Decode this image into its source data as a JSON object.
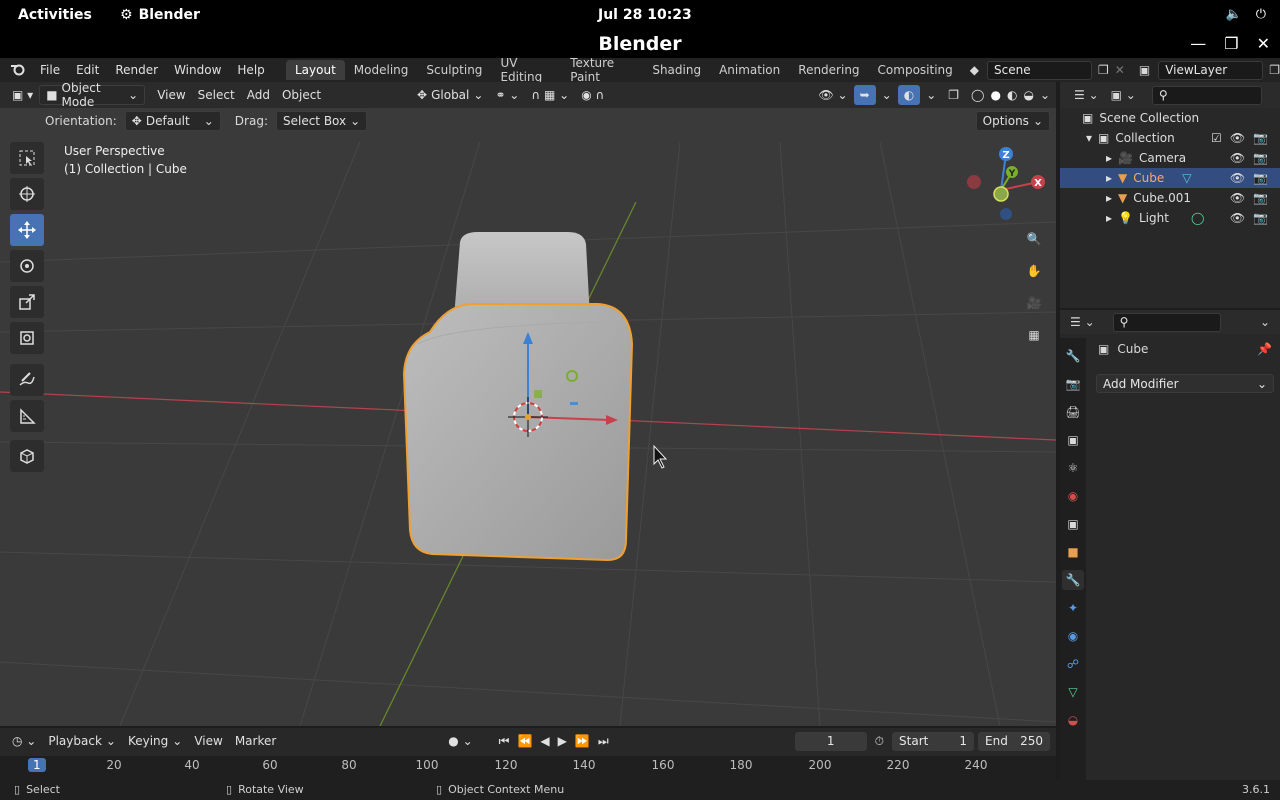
{
  "gnome": {
    "activities": "Activities",
    "app_name": "Blender",
    "clock": "Jul 28  10:23"
  },
  "window": {
    "title": "Blender"
  },
  "menu": {
    "file": "File",
    "edit": "Edit",
    "render": "Render",
    "window": "Window",
    "help": "Help"
  },
  "workspaces": [
    "Layout",
    "Modeling",
    "Sculpting",
    "UV Editing",
    "Texture Paint",
    "Shading",
    "Animation",
    "Rendering",
    "Compositing"
  ],
  "scene_field": "Scene",
  "view_layer_field": "ViewLayer",
  "viewport": {
    "mode": "Object Mode",
    "menus": {
      "view": "View",
      "select": "Select",
      "add": "Add",
      "object": "Object"
    },
    "transform_orientation": "Global",
    "orientation_label": "Orientation:",
    "orientation_value": "Default",
    "drag_label": "Drag:",
    "drag_value": "Select Box",
    "options": "Options",
    "overlay_line1": "User Perspective",
    "overlay_line2": "(1) Collection | Cube",
    "gizmo": {
      "z": "Z",
      "y": "Y",
      "x": "X"
    }
  },
  "outliner": {
    "scene_collection": "Scene Collection",
    "collection": "Collection",
    "items": [
      {
        "name": "Camera"
      },
      {
        "name": "Cube"
      },
      {
        "name": "Cube.001"
      },
      {
        "name": "Light"
      }
    ]
  },
  "properties": {
    "object_name": "Cube",
    "add_modifier": "Add Modifier"
  },
  "timeline": {
    "playback": "Playback",
    "keying": "Keying",
    "view": "View",
    "marker": "Marker",
    "current_frame": "1",
    "start_label": "Start",
    "start_value": "1",
    "end_label": "End",
    "end_value": "250",
    "ruler_marker": "1",
    "ticks": [
      "20",
      "40",
      "60",
      "80",
      "100",
      "120",
      "140",
      "160",
      "180",
      "200",
      "220",
      "240"
    ]
  },
  "status": {
    "select": "Select",
    "rotate_view": "Rotate View",
    "context_menu": "Object Context Menu",
    "version": "3.6.1"
  },
  "colors": {
    "accent": "#4772b3",
    "selection_outline": "#f0a030",
    "axis_x": "#c8404b",
    "axis_y": "#7bae2b",
    "axis_z": "#3b82d6"
  }
}
